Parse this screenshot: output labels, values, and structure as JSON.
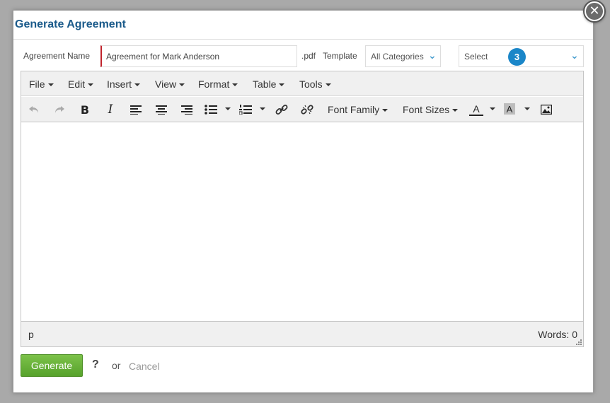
{
  "dialog": {
    "title": "Generate Agreement"
  },
  "form": {
    "name_label": "Agreement Name",
    "name_value": "Agreement for Mark Anderson",
    "extension": ".pdf",
    "template_label": "Template",
    "category_value": "All Categories",
    "select_value": "Select",
    "badge_count": "3"
  },
  "editor": {
    "menu": [
      "File",
      "Edit",
      "Insert",
      "View",
      "Format",
      "Table",
      "Tools"
    ],
    "font_family_label": "Font Family",
    "font_sizes_label": "Font Sizes",
    "text_color_glyph": "A",
    "bg_color_glyph": "A",
    "path": "p",
    "word_count": "Words: 0"
  },
  "actions": {
    "generate_label": "Generate",
    "help_label": "?",
    "or_label": "or",
    "cancel_label": "Cancel"
  },
  "colors": {
    "title": "#1a5a8a",
    "accent": "#1a86c8",
    "generate": "#6bb63c",
    "required": "#c0232c"
  }
}
